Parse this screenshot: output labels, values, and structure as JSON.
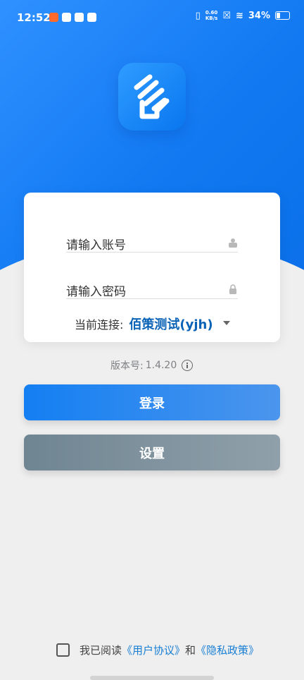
{
  "status_bar": {
    "time": "12:52",
    "network_speed": "0.60",
    "network_speed_unit": "KB/s",
    "battery": "34%"
  },
  "login_form": {
    "account_placeholder": "请输入账号",
    "password_placeholder": "请输入密码",
    "connection_label": "当前连接:",
    "connection_value": "佰策测试(yjh)"
  },
  "version": {
    "label": "版本号:",
    "value": "1.4.20"
  },
  "buttons": {
    "login": "登录",
    "settings": "设置"
  },
  "agreement": {
    "prefix": "我已阅读",
    "user_agreement": "《用户协议》",
    "and": "和",
    "privacy_policy": "《隐私政策》"
  },
  "colors": {
    "primary_blue": "#147ff2",
    "link_blue": "#177ed3",
    "settings_gray": "#6f8592"
  },
  "icons": [
    "hand-icon",
    "user-icon",
    "lock-icon",
    "info-icon",
    "checkbox-icon"
  ]
}
